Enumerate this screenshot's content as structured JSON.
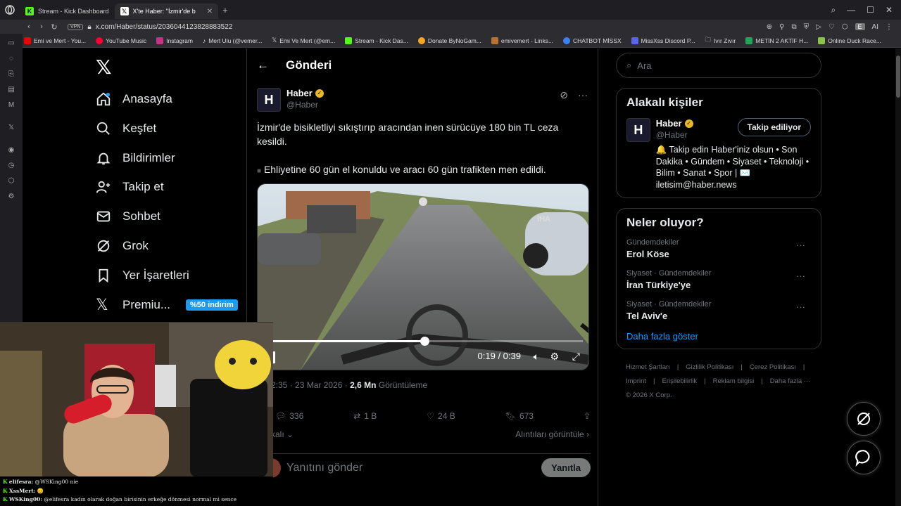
{
  "browser": {
    "tabs": [
      {
        "label": "Stream - Kick Dashboard",
        "icon": "kick-icon",
        "active": false
      },
      {
        "label": "X'te Haber: \"İzmir'de b",
        "icon": "x-icon",
        "active": true
      }
    ],
    "url": "x.com/Haber/status/2036044123828883522",
    "vpn": "VPN",
    "ai_label": "AI",
    "profile_initial": "E",
    "bookmarks": [
      "Emi ve Mert - You...",
      "YouTube Music",
      "Instagram",
      "Mert Ulu (@vemer...",
      "Emi Ve Mert (@em...",
      "Stream - Kick Das...",
      "Donate ByNoGam...",
      "emivemert - Links...",
      "CHATBOT MİSSX",
      "MissXss Discord P...",
      "Ivır Zıvır",
      "METİN 2 AKTİF H...",
      "Online Duck Race..."
    ]
  },
  "nav": {
    "items": [
      {
        "label": "Anasayfa",
        "icon": "home-icon"
      },
      {
        "label": "Keşfet",
        "icon": "search-icon"
      },
      {
        "label": "Bildirimler",
        "icon": "bell-icon"
      },
      {
        "label": "Takip et",
        "icon": "follow-icon"
      },
      {
        "label": "Sohbet",
        "icon": "mail-icon"
      },
      {
        "label": "Grok",
        "icon": "grok-icon"
      },
      {
        "label": "Yer İşaretleri",
        "icon": "bookmark-icon"
      },
      {
        "label": "Premiu...",
        "icon": "x-premium-icon"
      }
    ],
    "promo": "%50 indirim"
  },
  "post": {
    "header": "Gönderi",
    "author_name": "Haber",
    "author_handle": "@Haber",
    "text": "İzmir'de bisikletliyi sıkıştırıp aracından inen sürücüye 180 bin TL ceza kesildi.",
    "text2": "Ehliyetine 60 gün el konuldu ve aracı 60 gün trafikten men edildi.",
    "video": {
      "time": "0:19 / 0:39",
      "progress": 0.49,
      "watermark": "İHA"
    },
    "time_date": "2:35 · 23 Mar 2026 ·",
    "views": "2,6 Mn",
    "views_label": "Görüntüleme",
    "replies": "336",
    "reposts": "1 B",
    "likes": "24 B",
    "bookmarks": "673",
    "sort_label": "kalı",
    "quotes_label": "Alıntıları görüntüle",
    "reply_placeholder": "Yanıtını gönder",
    "reply_button": "Yanıtla"
  },
  "right": {
    "search_placeholder": "Ara",
    "relevant_title": "Alakalı kişiler",
    "person_name": "Haber",
    "person_handle": "@Haber",
    "follow_button": "Takip ediliyor",
    "bio": "🔔 Takip edin Haber'iniz olsun • Son Dakika • Gündem • Siyaset • Teknoloji • Bilim • Sanat • Spor | ✉️ iletisim@haber.news",
    "trending_title": "Neler oluyor?",
    "trends": [
      {
        "category": "Gündemdekiler",
        "title": "Erol Köse"
      },
      {
        "category": "Siyaset · Gündemdekiler",
        "title": "İran Türkiye'ye"
      },
      {
        "category": "Siyaset · Gündemdekiler",
        "title": "Tel Aviv'e"
      }
    ],
    "show_more": "Daha fazla göster",
    "footer": [
      "Hizmet Şartları",
      "|",
      "Gizlilik Politikası",
      "|",
      "Çerez Politikası",
      "|",
      "Imprint",
      "|",
      "Erişilebilirlik",
      "|",
      "Reklam bilgisi",
      "|",
      "Daha fazla ···",
      "© 2026 X Corp."
    ]
  },
  "chat": [
    {
      "user": "elifesra:",
      "text": "@WSKing00 nie"
    },
    {
      "user": "XssMert:",
      "text": "😊"
    },
    {
      "user": "WSKing00:",
      "text": "@elifesra kadın olarak doğan birisinin erkeğe dönmesi normal mi sence"
    }
  ]
}
